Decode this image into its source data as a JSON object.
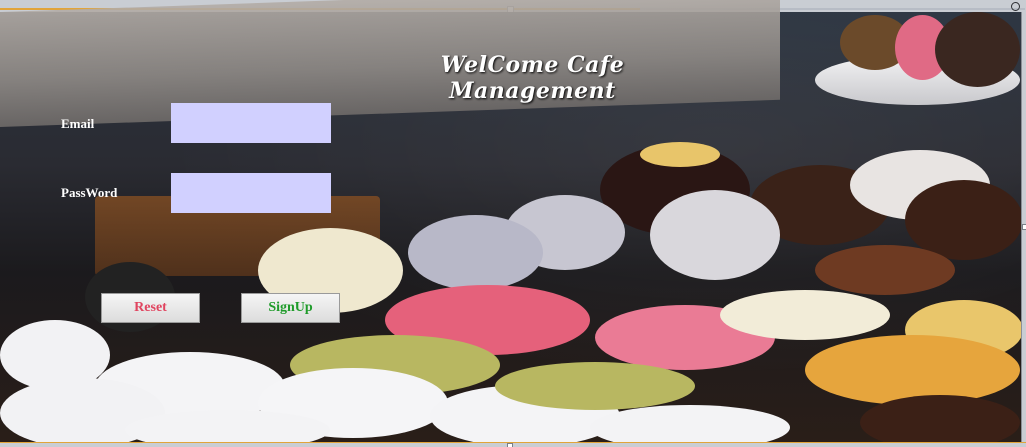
{
  "window": {
    "title": "WelCome Cafe Management"
  },
  "form": {
    "email": {
      "label": "Email",
      "value": ""
    },
    "password": {
      "label": "PassWord",
      "value": ""
    }
  },
  "buttons": {
    "reset": {
      "label": "Reset",
      "color": "#e0445f"
    },
    "signup": {
      "label": "SignUp",
      "color": "#1f9b2a"
    }
  },
  "colors": {
    "input_background": "#d1d0ff",
    "title_text": "#ffffff",
    "label_text": "#ffffff"
  }
}
